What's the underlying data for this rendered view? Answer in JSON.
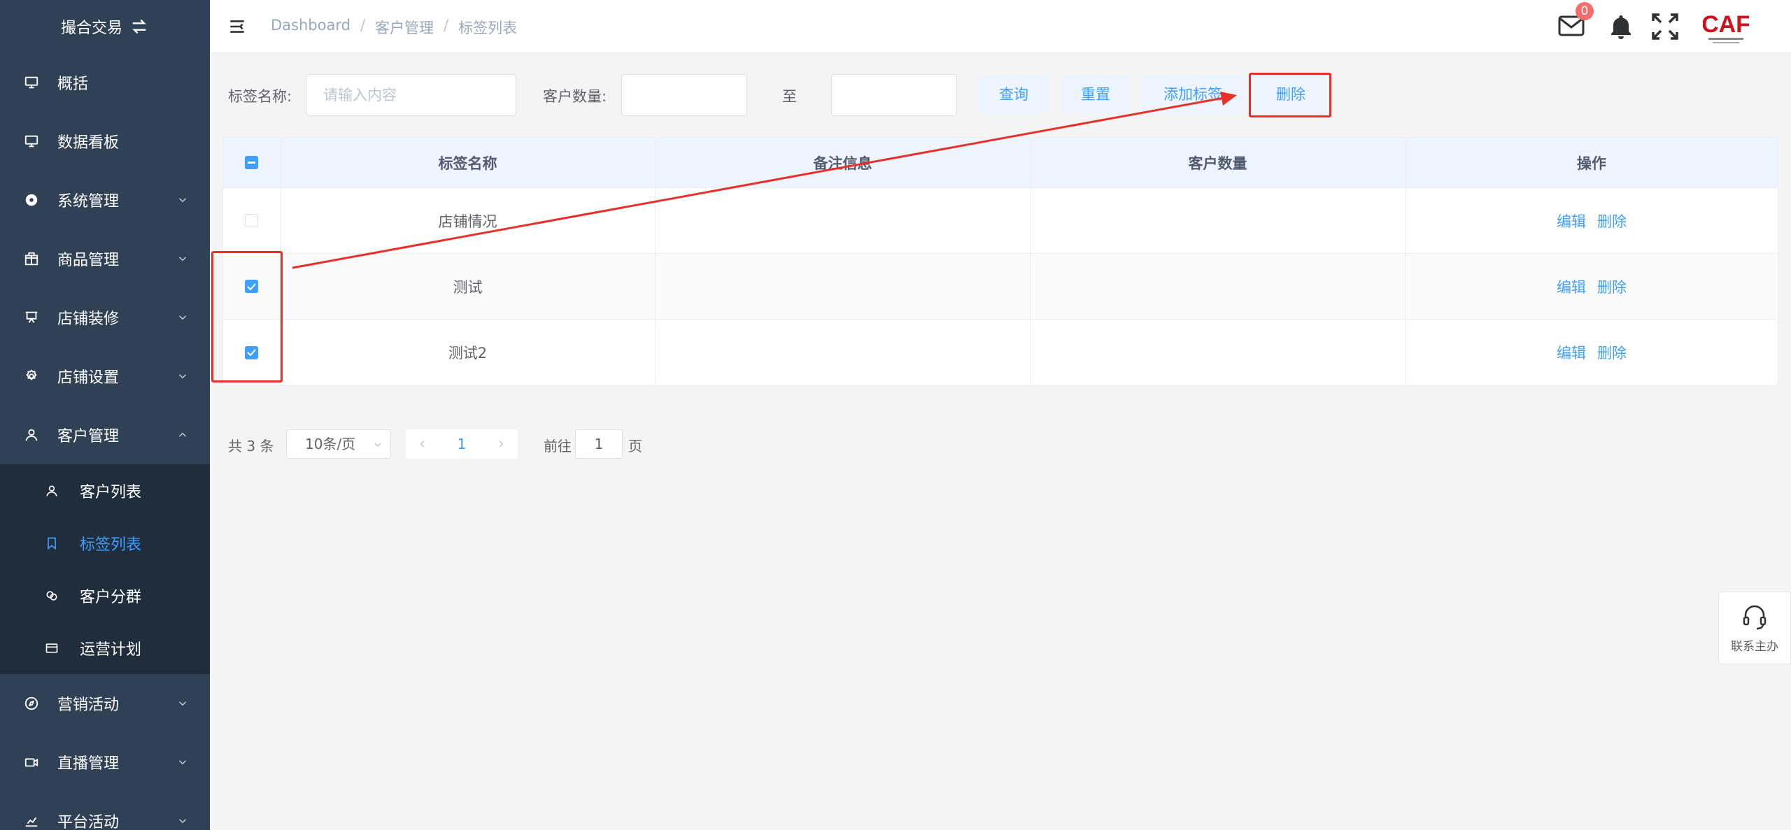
{
  "app": {
    "title": "撮合交易"
  },
  "colors": {
    "sidebar_bg": "#304156",
    "submenu_bg": "#1f2d3d",
    "accent": "#409eff",
    "annotation": "#e8302a",
    "badge": "#f56c6c"
  },
  "sidebar": {
    "items": [
      {
        "label": "概括",
        "icon": "monitor-icon"
      },
      {
        "label": "数据看板",
        "icon": "monitor-icon"
      },
      {
        "label": "系统管理",
        "icon": "settings-icon"
      },
      {
        "label": "商品管理",
        "icon": "box-icon"
      },
      {
        "label": "店铺装修",
        "icon": "easel-icon"
      },
      {
        "label": "店铺设置",
        "icon": "gear-icon"
      },
      {
        "label": "客户管理",
        "icon": "user-icon"
      }
    ],
    "submenu": [
      {
        "label": "客户列表",
        "icon": "user-icon"
      },
      {
        "label": "标签列表",
        "icon": "bookmark-icon"
      },
      {
        "label": "客户分群",
        "icon": "group-icon"
      },
      {
        "label": "运营计划",
        "icon": "card-icon"
      }
    ],
    "items_after": [
      {
        "label": "营销活动",
        "icon": "compass-icon"
      },
      {
        "label": "直播管理",
        "icon": "camera-icon"
      },
      {
        "label": "平台活动",
        "icon": "chart-icon"
      }
    ]
  },
  "header": {
    "breadcrumb": [
      "Dashboard",
      "客户管理",
      "标签列表"
    ],
    "breadcrumb_sep": "/",
    "mail_badge": "0",
    "logo_text": "CAF"
  },
  "filter": {
    "name_label": "标签名称:",
    "name_placeholder": "请输入内容",
    "count_label": "客户数量:",
    "range_sep": "至",
    "btn_query": "查询",
    "btn_reset": "重置",
    "btn_add": "添加标签",
    "btn_delete": "删除"
  },
  "table": {
    "headers": [
      "标签名称",
      "备注信息",
      "客户数量",
      "操作"
    ],
    "rows": [
      {
        "name": "店铺情况",
        "note": "",
        "count": "",
        "checked": false
      },
      {
        "name": "测试",
        "note": "",
        "count": "",
        "checked": true
      },
      {
        "name": "测试2",
        "note": "",
        "count": "",
        "checked": true
      }
    ],
    "op_edit": "编辑",
    "op_delete": "删除"
  },
  "pagination": {
    "total": "共 3 条",
    "page_size": "10条/页",
    "current": "1",
    "goto_label": "前往",
    "goto_value": "1",
    "page_unit": "页"
  },
  "contact": {
    "label": "联系主办"
  }
}
